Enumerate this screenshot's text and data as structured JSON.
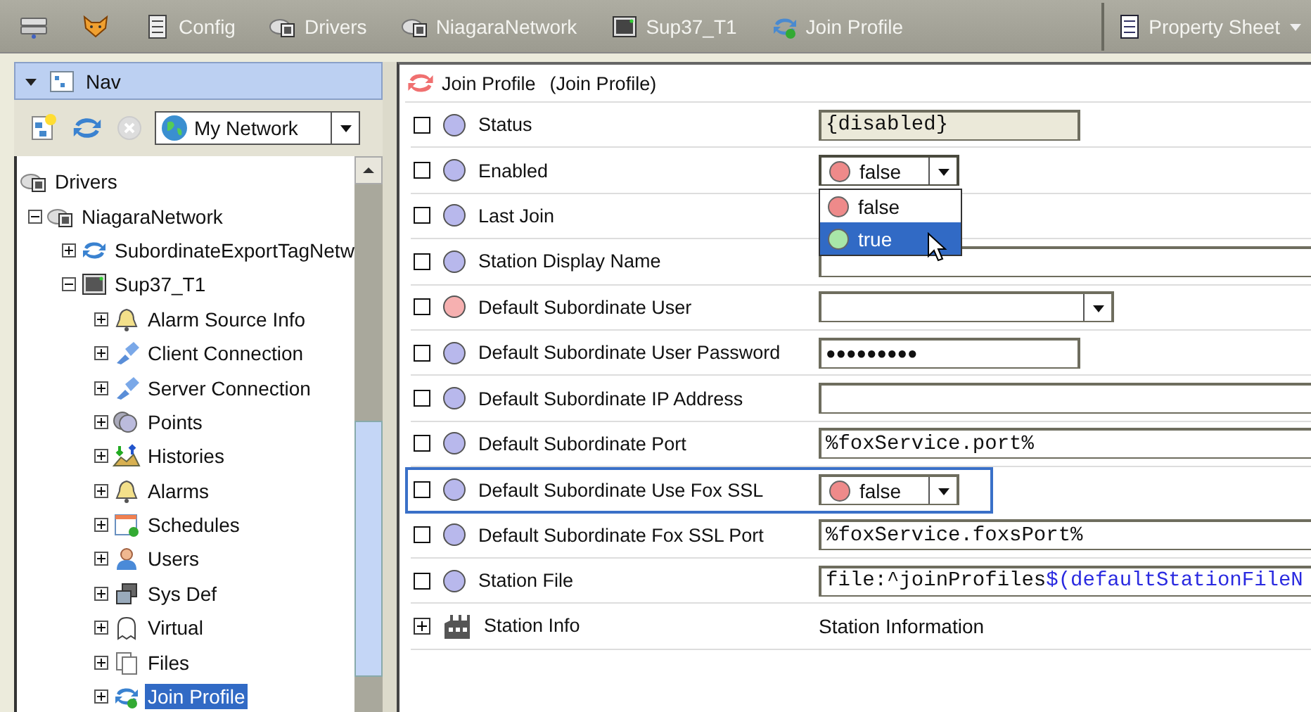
{
  "toolbar": {
    "items": [
      {
        "kind": "station"
      },
      {
        "kind": "fox"
      },
      {
        "kind": "config",
        "label": "Config"
      },
      {
        "kind": "driver",
        "label": "Drivers"
      },
      {
        "kind": "driver",
        "label": "NiagaraNetwork"
      },
      {
        "kind": "device",
        "label": "Sup37_T1"
      },
      {
        "kind": "join",
        "label": "Join Profile"
      }
    ],
    "view_selector": {
      "label": "Property Sheet"
    }
  },
  "nav": {
    "title": "Nav",
    "network": "My Network",
    "tree": [
      {
        "label": "Drivers",
        "kind": "driver",
        "children": [
          {
            "label": "NiagaraNetwork",
            "kind": "driver",
            "expanded": true,
            "children": [
              {
                "label": "SubordinateExportTagNetw",
                "kind": "sync",
                "expanded": false,
                "selected": false
              },
              {
                "label": "Sup37_T1",
                "kind": "device",
                "expanded": true,
                "children": [
                  {
                    "label": "Alarm Source Info",
                    "kind": "bell",
                    "expanded": false,
                    "selected": false
                  },
                  {
                    "label": "Client Connection",
                    "kind": "plug",
                    "expanded": false,
                    "selected": false
                  },
                  {
                    "label": "Server Connection",
                    "kind": "plug",
                    "expanded": false,
                    "selected": false
                  },
                  {
                    "label": "Points",
                    "kind": "points",
                    "expanded": false,
                    "selected": false
                  },
                  {
                    "label": "Histories",
                    "kind": "histories",
                    "expanded": false,
                    "selected": false
                  },
                  {
                    "label": "Alarms",
                    "kind": "bell",
                    "expanded": false,
                    "selected": false
                  },
                  {
                    "label": "Schedules",
                    "kind": "calendar",
                    "expanded": false,
                    "selected": false
                  },
                  {
                    "label": "Users",
                    "kind": "user",
                    "expanded": false,
                    "selected": false
                  },
                  {
                    "label": "Sys Def",
                    "kind": "sysdef",
                    "expanded": false,
                    "selected": false
                  },
                  {
                    "label": "Virtual",
                    "kind": "ghost",
                    "expanded": false,
                    "selected": false
                  },
                  {
                    "label": "Files",
                    "kind": "files",
                    "expanded": false,
                    "selected": false
                  },
                  {
                    "label": "Join Profile",
                    "kind": "join",
                    "expanded": false,
                    "selected": true
                  }
                ],
                "selected": false
              }
            ],
            "selected": false
          }
        ],
        "selected": false
      }
    ]
  },
  "sheet": {
    "title": "Join Profile",
    "subtitle": "(Join Profile)",
    "rows": [
      {
        "label": "Status",
        "kind": "readonly",
        "checked": false,
        "color": "#b8b8ec",
        "value": "{disabled}"
      },
      {
        "label": "Enabled",
        "kind": "dropdown",
        "checked": false,
        "color": "#b8b8ec",
        "current": {
          "label": "false",
          "color": "#ee8a8a"
        },
        "open": true,
        "options": [
          {
            "label": "false",
            "color": "#ee8a8a",
            "selected": false
          },
          {
            "label": "true",
            "color": "#a8e6a8",
            "selected": true
          }
        ]
      },
      {
        "label": "Last Join",
        "kind": "none",
        "checked": false,
        "color": "#b8b8ec"
      },
      {
        "label": "Station Display Name",
        "kind": "text",
        "checked": false,
        "color": "#b8b8ec"
      },
      {
        "label": "Default Subordinate User",
        "kind": "combo",
        "checked": false,
        "color": "#f6b0b0"
      },
      {
        "label": "Default Subordinate User Password",
        "kind": "password",
        "checked": false,
        "color": "#b8b8ec",
        "value": "●●●●●●●●●"
      },
      {
        "label": "Default Subordinate IP Address",
        "kind": "text",
        "checked": false,
        "color": "#b8b8ec"
      },
      {
        "label": "Default Subordinate Port",
        "kind": "text",
        "checked": false,
        "color": "#b8b8ec",
        "value": "%foxService.port%"
      },
      {
        "label": "Default Subordinate Use Fox SSL",
        "kind": "dropdown",
        "checked": false,
        "color": "#b8b8ec",
        "current": {
          "label": "false",
          "color": "#ee8a8a"
        },
        "focused": true
      },
      {
        "label": "Default Subordinate Fox SSL Port",
        "kind": "text",
        "checked": false,
        "color": "#b8b8ec",
        "value": "%foxService.foxsPort%"
      },
      {
        "label": "Station File",
        "kind": "text",
        "checked": false,
        "color": "#b8b8ec",
        "value_parts": [
          {
            "kind": "plain",
            "text": "file:^joinProfiles"
          },
          {
            "kind": "variable",
            "text": "$(defaultStationFileN"
          }
        ]
      },
      {
        "label": "Station Info",
        "kind": "section",
        "expanded": false,
        "value": "Station Information"
      }
    ]
  }
}
